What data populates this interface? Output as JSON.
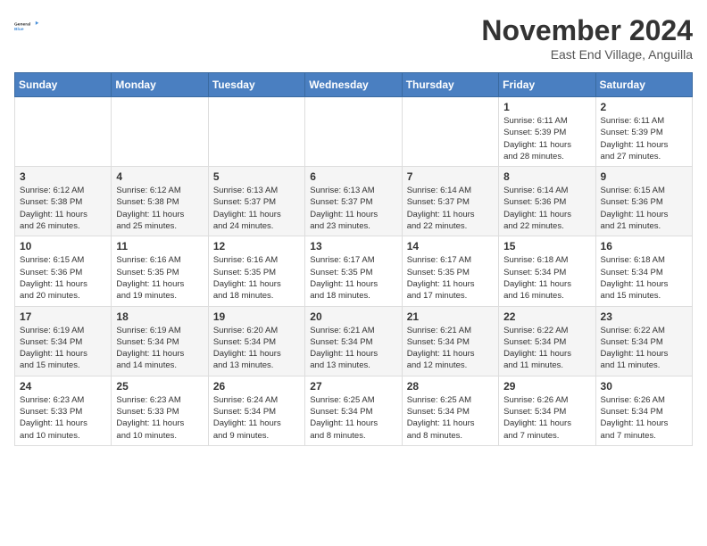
{
  "logo": {
    "line1": "General",
    "line2": "Blue"
  },
  "title": "November 2024",
  "location": "East End Village, Anguilla",
  "days_header": [
    "Sunday",
    "Monday",
    "Tuesday",
    "Wednesday",
    "Thursday",
    "Friday",
    "Saturday"
  ],
  "weeks": [
    [
      {
        "day": "",
        "info": ""
      },
      {
        "day": "",
        "info": ""
      },
      {
        "day": "",
        "info": ""
      },
      {
        "day": "",
        "info": ""
      },
      {
        "day": "",
        "info": ""
      },
      {
        "day": "1",
        "info": "Sunrise: 6:11 AM\nSunset: 5:39 PM\nDaylight: 11 hours\nand 28 minutes."
      },
      {
        "day": "2",
        "info": "Sunrise: 6:11 AM\nSunset: 5:39 PM\nDaylight: 11 hours\nand 27 minutes."
      }
    ],
    [
      {
        "day": "3",
        "info": "Sunrise: 6:12 AM\nSunset: 5:38 PM\nDaylight: 11 hours\nand 26 minutes."
      },
      {
        "day": "4",
        "info": "Sunrise: 6:12 AM\nSunset: 5:38 PM\nDaylight: 11 hours\nand 25 minutes."
      },
      {
        "day": "5",
        "info": "Sunrise: 6:13 AM\nSunset: 5:37 PM\nDaylight: 11 hours\nand 24 minutes."
      },
      {
        "day": "6",
        "info": "Sunrise: 6:13 AM\nSunset: 5:37 PM\nDaylight: 11 hours\nand 23 minutes."
      },
      {
        "day": "7",
        "info": "Sunrise: 6:14 AM\nSunset: 5:37 PM\nDaylight: 11 hours\nand 22 minutes."
      },
      {
        "day": "8",
        "info": "Sunrise: 6:14 AM\nSunset: 5:36 PM\nDaylight: 11 hours\nand 22 minutes."
      },
      {
        "day": "9",
        "info": "Sunrise: 6:15 AM\nSunset: 5:36 PM\nDaylight: 11 hours\nand 21 minutes."
      }
    ],
    [
      {
        "day": "10",
        "info": "Sunrise: 6:15 AM\nSunset: 5:36 PM\nDaylight: 11 hours\nand 20 minutes."
      },
      {
        "day": "11",
        "info": "Sunrise: 6:16 AM\nSunset: 5:35 PM\nDaylight: 11 hours\nand 19 minutes."
      },
      {
        "day": "12",
        "info": "Sunrise: 6:16 AM\nSunset: 5:35 PM\nDaylight: 11 hours\nand 18 minutes."
      },
      {
        "day": "13",
        "info": "Sunrise: 6:17 AM\nSunset: 5:35 PM\nDaylight: 11 hours\nand 18 minutes."
      },
      {
        "day": "14",
        "info": "Sunrise: 6:17 AM\nSunset: 5:35 PM\nDaylight: 11 hours\nand 17 minutes."
      },
      {
        "day": "15",
        "info": "Sunrise: 6:18 AM\nSunset: 5:34 PM\nDaylight: 11 hours\nand 16 minutes."
      },
      {
        "day": "16",
        "info": "Sunrise: 6:18 AM\nSunset: 5:34 PM\nDaylight: 11 hours\nand 15 minutes."
      }
    ],
    [
      {
        "day": "17",
        "info": "Sunrise: 6:19 AM\nSunset: 5:34 PM\nDaylight: 11 hours\nand 15 minutes."
      },
      {
        "day": "18",
        "info": "Sunrise: 6:19 AM\nSunset: 5:34 PM\nDaylight: 11 hours\nand 14 minutes."
      },
      {
        "day": "19",
        "info": "Sunrise: 6:20 AM\nSunset: 5:34 PM\nDaylight: 11 hours\nand 13 minutes."
      },
      {
        "day": "20",
        "info": "Sunrise: 6:21 AM\nSunset: 5:34 PM\nDaylight: 11 hours\nand 13 minutes."
      },
      {
        "day": "21",
        "info": "Sunrise: 6:21 AM\nSunset: 5:34 PM\nDaylight: 11 hours\nand 12 minutes."
      },
      {
        "day": "22",
        "info": "Sunrise: 6:22 AM\nSunset: 5:34 PM\nDaylight: 11 hours\nand 11 minutes."
      },
      {
        "day": "23",
        "info": "Sunrise: 6:22 AM\nSunset: 5:34 PM\nDaylight: 11 hours\nand 11 minutes."
      }
    ],
    [
      {
        "day": "24",
        "info": "Sunrise: 6:23 AM\nSunset: 5:33 PM\nDaylight: 11 hours\nand 10 minutes."
      },
      {
        "day": "25",
        "info": "Sunrise: 6:23 AM\nSunset: 5:33 PM\nDaylight: 11 hours\nand 10 minutes."
      },
      {
        "day": "26",
        "info": "Sunrise: 6:24 AM\nSunset: 5:34 PM\nDaylight: 11 hours\nand 9 minutes."
      },
      {
        "day": "27",
        "info": "Sunrise: 6:25 AM\nSunset: 5:34 PM\nDaylight: 11 hours\nand 8 minutes."
      },
      {
        "day": "28",
        "info": "Sunrise: 6:25 AM\nSunset: 5:34 PM\nDaylight: 11 hours\nand 8 minutes."
      },
      {
        "day": "29",
        "info": "Sunrise: 6:26 AM\nSunset: 5:34 PM\nDaylight: 11 hours\nand 7 minutes."
      },
      {
        "day": "30",
        "info": "Sunrise: 6:26 AM\nSunset: 5:34 PM\nDaylight: 11 hours\nand 7 minutes."
      }
    ]
  ]
}
